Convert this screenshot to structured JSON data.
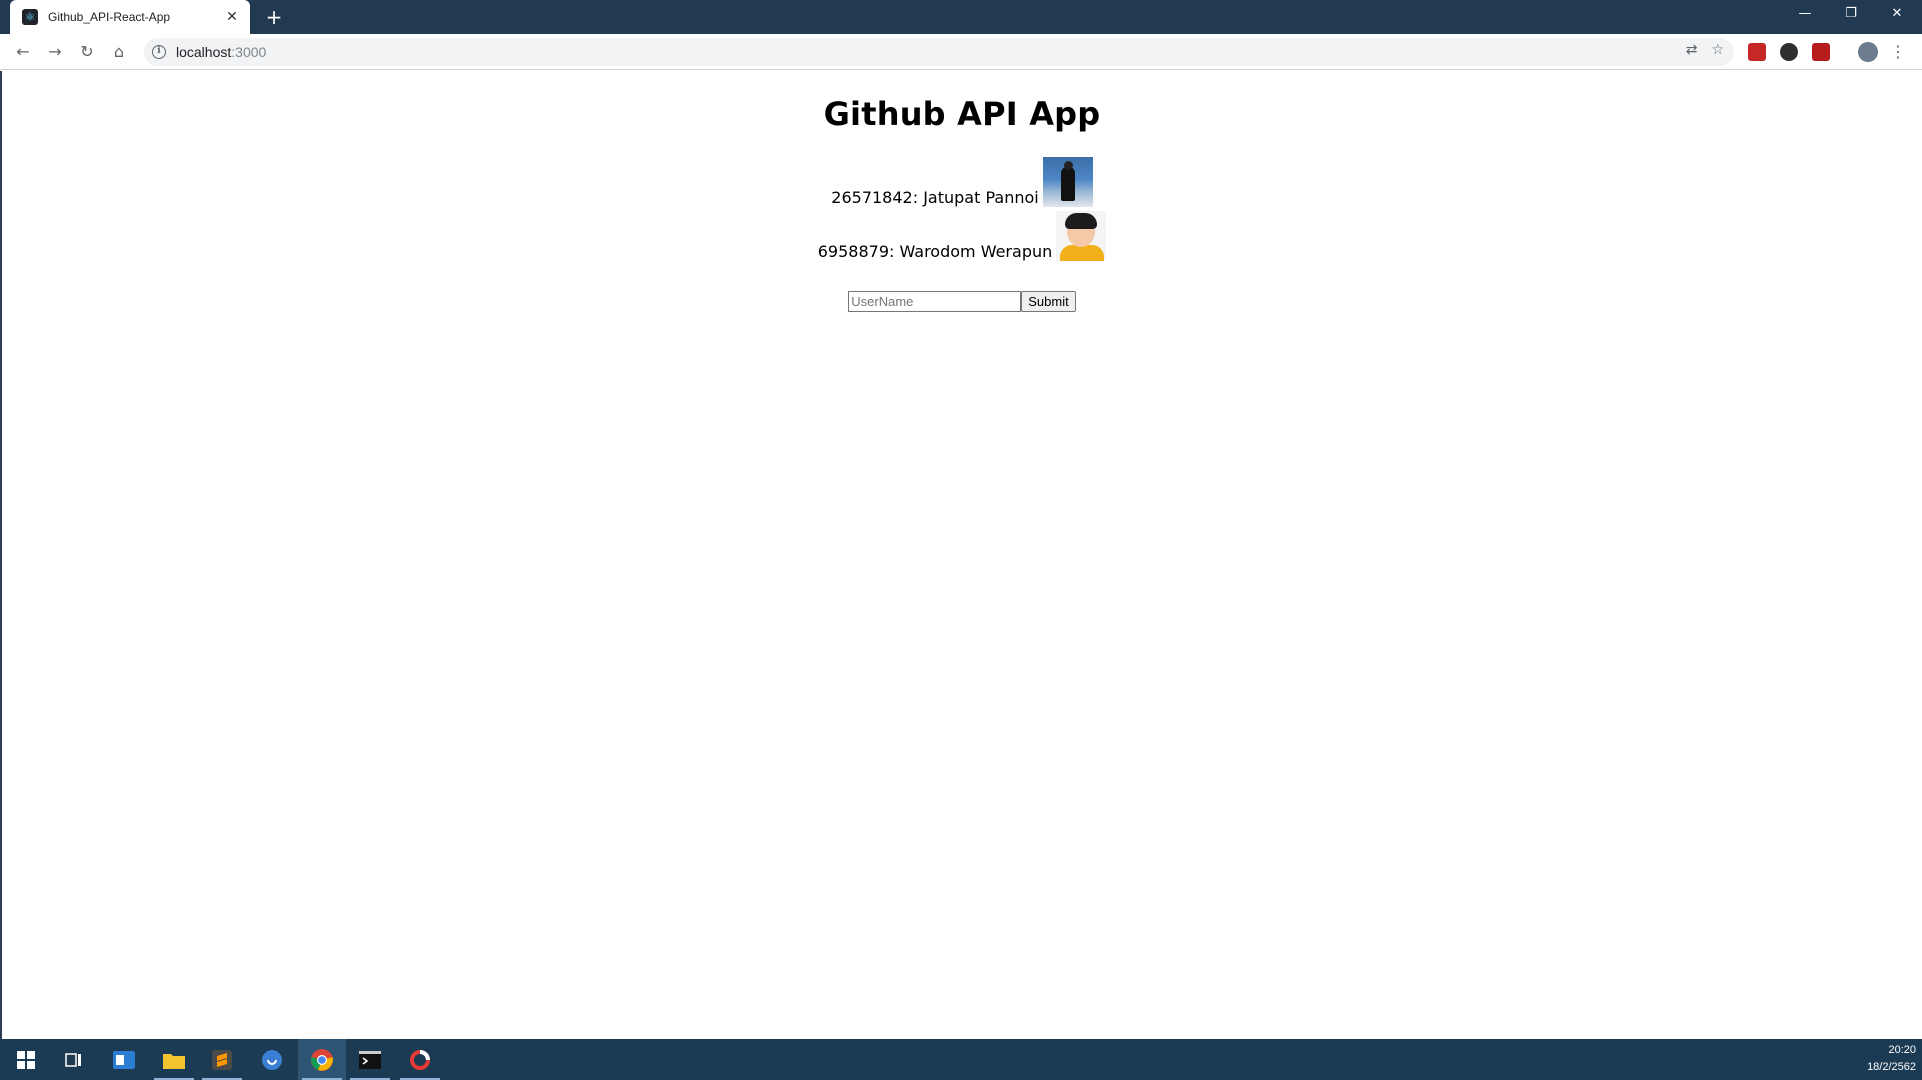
{
  "browser": {
    "tab_title": "Github_API-React-App",
    "url_host": "localhost",
    "url_port": ":3000"
  },
  "app": {
    "title": "Github API App",
    "users": [
      {
        "label": "26571842: Jatupat Pannoi"
      },
      {
        "label": "6958879: Warodom Werapun"
      }
    ],
    "form": {
      "placeholder": "UserName",
      "submit_label": "Submit"
    }
  },
  "taskbar": {
    "time": "20:20",
    "date": "18/2/2562"
  },
  "colors": {
    "titlebar": "#213a52",
    "taskbar": "#1b3a54"
  }
}
